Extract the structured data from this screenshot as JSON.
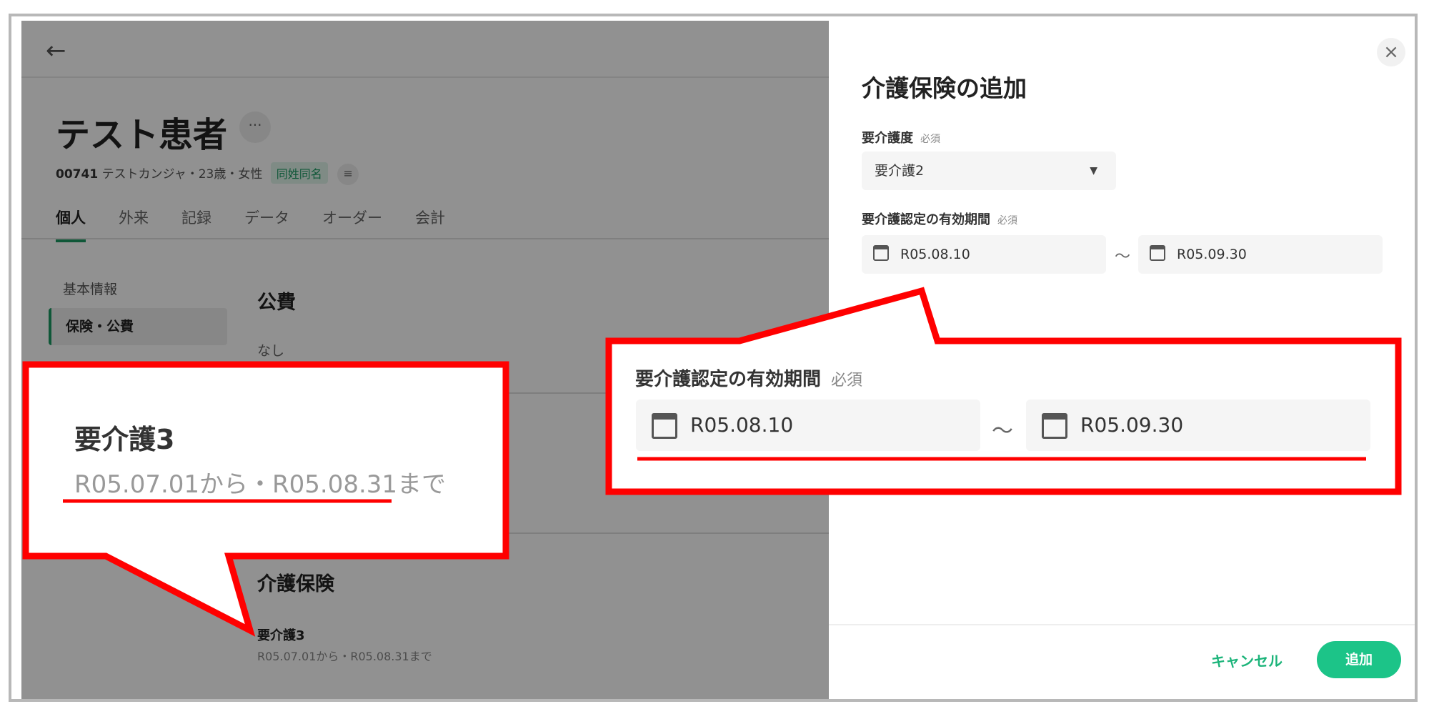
{
  "background_page": {
    "patient_name": "テスト患者",
    "more_button": "···",
    "patient_id": "00741",
    "patient_info": "テストカンジャ・23歳・女性",
    "same_name_badge": "同姓同名",
    "tabs": [
      "個人",
      "外来",
      "記録",
      "データ",
      "オーダー",
      "会計"
    ],
    "side_menu": [
      "基本情報",
      "保険・公費"
    ],
    "public_funding_title": "公費",
    "public_funding_value": "なし",
    "care_insurance_title": "介護保険",
    "care_level": "要介護3",
    "care_period": "R05.07.01から・R05.08.31まで"
  },
  "drawer": {
    "title": "介護保険の追加",
    "care_level_label": "要介護度",
    "required": "必須",
    "care_level_value": "要介護2",
    "period_label": "要介護認定の有効期間",
    "date_from": "R05.08.10",
    "date_to": "R05.09.30",
    "tilde": "～",
    "cancel_label": "キャンセル",
    "add_label": "追加"
  },
  "callout_left": {
    "level": "要介護3",
    "range": "R05.07.01から・R05.08.31まで"
  },
  "callout_right": {
    "label": "要介護認定の有効期間",
    "required": "必須",
    "date_from": "R05.08.10",
    "date_to": "R05.09.30",
    "tilde": "～"
  },
  "colors": {
    "accent": "#1cc488",
    "callout_border": "#ff0000"
  }
}
